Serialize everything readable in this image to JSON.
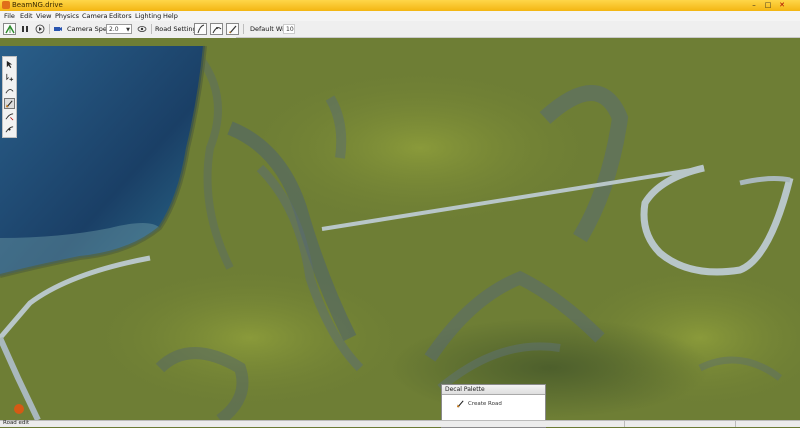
{
  "window": {
    "title": "BeamNG.drive"
  },
  "menu": [
    "File",
    "Edit",
    "View",
    "Physics",
    "Camera",
    "Editors",
    "Lighting",
    "Help"
  ],
  "toolbar": {
    "camera_speed_label": "Camera Speed",
    "camera_speed_value": "2.0",
    "road_settings_label": "Road Settings",
    "default_width_label": "Default Width",
    "default_width_value": "10"
  },
  "palette": {
    "title": "Decal Palette",
    "item_label": "Create Road"
  },
  "status": {
    "text": "Road edit"
  },
  "colors": {
    "titlebar": "#f3b512",
    "water": "#1d4a72",
    "terrain": "#6e7e35",
    "road": "#b8c6c8"
  }
}
